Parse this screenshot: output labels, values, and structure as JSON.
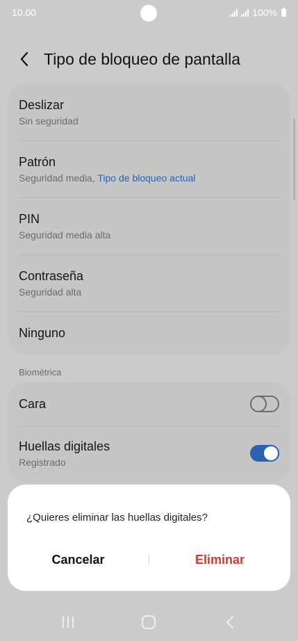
{
  "status_bar": {
    "time": "10.00",
    "battery": "100%"
  },
  "header": {
    "title": "Tipo de bloqueo de pantalla"
  },
  "lock_options": [
    {
      "title": "Deslizar",
      "subtitle": "Sin seguridad"
    },
    {
      "title": "Patrón",
      "subtitle": "Seguridad media, ",
      "current": "Tipo de bloqueo actual"
    },
    {
      "title": "PIN",
      "subtitle": "Seguridad media alta"
    },
    {
      "title": "Contraseña",
      "subtitle": "Seguridad alta"
    },
    {
      "title": "Ninguno"
    }
  ],
  "biometrics": {
    "section_label": "Biométrica",
    "face": {
      "title": "Cara",
      "enabled": false
    },
    "fingerprints": {
      "title": "Huellas digitales",
      "subtitle": "Registrado",
      "enabled": true
    }
  },
  "dialog": {
    "message": "¿Quieres eliminar las huellas digitales?",
    "cancel_label": "Cancelar",
    "delete_label": "Eliminar"
  },
  "colors": {
    "accent": "#2a62b0",
    "danger": "#d33a32"
  }
}
